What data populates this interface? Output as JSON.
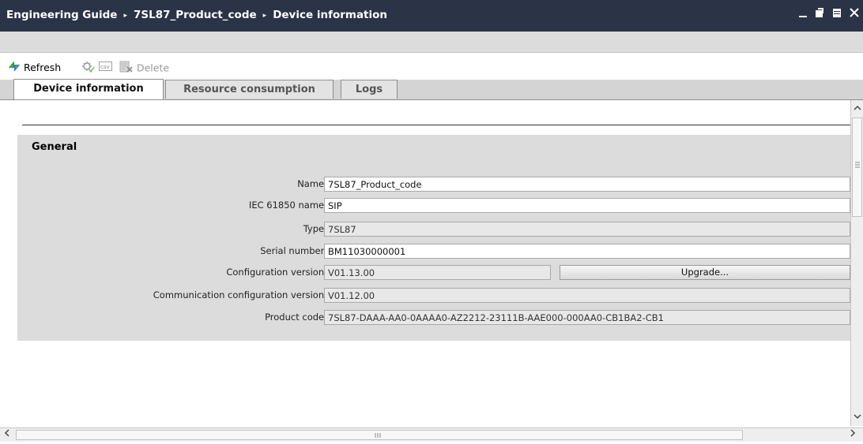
{
  "title_bar": {
    "breadcrumbs": [
      "Engineering Guide",
      "7SL87_Product_code",
      "Device information"
    ],
    "separator": "▸",
    "window_buttons": [
      "minimize-icon",
      "restore-icon",
      "maximize-icon",
      "close-icon"
    ]
  },
  "toolbar": {
    "refresh_label": "Refresh",
    "csv_label": "csv",
    "delete_label": "Delete"
  },
  "tabs": [
    {
      "label": "Device information",
      "active": true
    },
    {
      "label": "Resource consumption",
      "active": false
    },
    {
      "label": "Logs",
      "active": false
    }
  ],
  "general": {
    "title": "General",
    "fields": [
      {
        "label": "Name:",
        "value": "7SL87_Product_code",
        "editable": true
      },
      {
        "label": "IEC 61850 name:",
        "value": "SIP",
        "editable": true
      },
      {
        "label": "Type:",
        "value": "7SL87",
        "editable": false
      },
      {
        "label": "Serial number:",
        "value": "BM11030000001",
        "editable": true
      },
      {
        "label": "Configuration version:",
        "value": "V01.13.00",
        "editable": false
      },
      {
        "label": "Communication configuration version:",
        "value": "V01.12.00",
        "editable": false
      },
      {
        "label": "Product code:",
        "value": "7SL87-DAAA-AA0-0AAAA0-AZ2212-23111B-AAE000-000AA0-CB1BA2-CB1",
        "editable": false
      }
    ],
    "upgrade_button": "Upgrade..."
  },
  "colors": {
    "title_bar": "#2b3347",
    "panel": "#dcdcdc",
    "refresh_icon": "#3a9a2a"
  }
}
